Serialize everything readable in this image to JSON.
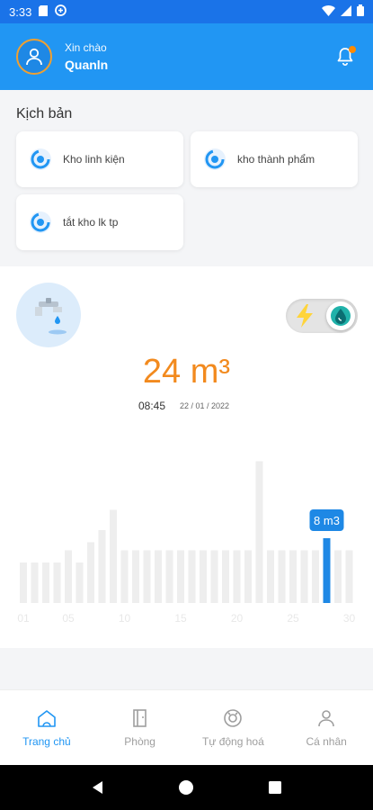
{
  "status_bar": {
    "time": "3:33"
  },
  "header": {
    "greeting": "Xin chào",
    "username": "Quanln"
  },
  "scenarios": {
    "title": "Kịch bản",
    "items": [
      {
        "label": "Kho linh kiện"
      },
      {
        "label": "kho thành phẩm"
      },
      {
        "label": "tắt kho lk tp"
      }
    ]
  },
  "consumption": {
    "value_text": "24 m³",
    "time": "08:45",
    "date": "22 / 01 / 2022",
    "accent_color": "#f28a1e"
  },
  "chart_data": {
    "type": "bar",
    "categories": [
      "01",
      "02",
      "03",
      "04",
      "05",
      "06",
      "07",
      "08",
      "09",
      "10",
      "11",
      "12",
      "13",
      "14",
      "15",
      "16",
      "17",
      "18",
      "19",
      "20",
      "21",
      "22",
      "23",
      "24",
      "25",
      "26",
      "27",
      "28",
      "29",
      "30"
    ],
    "values": [
      5,
      5,
      5,
      5,
      6.5,
      5,
      7.5,
      9,
      11.5,
      6.5,
      6.5,
      6.5,
      6.5,
      6.5,
      6.5,
      6.5,
      6.5,
      6.5,
      6.5,
      6.5,
      6.5,
      17.5,
      6.5,
      6.5,
      6.5,
      6.5,
      6.5,
      8,
      6.5,
      6.5
    ],
    "highlight_index": 27,
    "highlight_label": "8 m3",
    "tick_labels": [
      "01",
      "05",
      "10",
      "15",
      "20",
      "25",
      "30"
    ],
    "tick_indices": [
      0,
      4,
      9,
      14,
      19,
      24,
      29
    ],
    "ylim": [
      0,
      20
    ],
    "bar_color": "#eeeeee",
    "highlight_color": "#1e88e5"
  },
  "bottom_nav": {
    "items": [
      {
        "label": "Trang chủ",
        "icon": "home-icon",
        "active": true
      },
      {
        "label": "Phòng",
        "icon": "door-icon",
        "active": false
      },
      {
        "label": "Tự động hoá",
        "icon": "automation-icon",
        "active": false
      },
      {
        "label": "Cá nhân",
        "icon": "person-icon",
        "active": false
      }
    ]
  }
}
